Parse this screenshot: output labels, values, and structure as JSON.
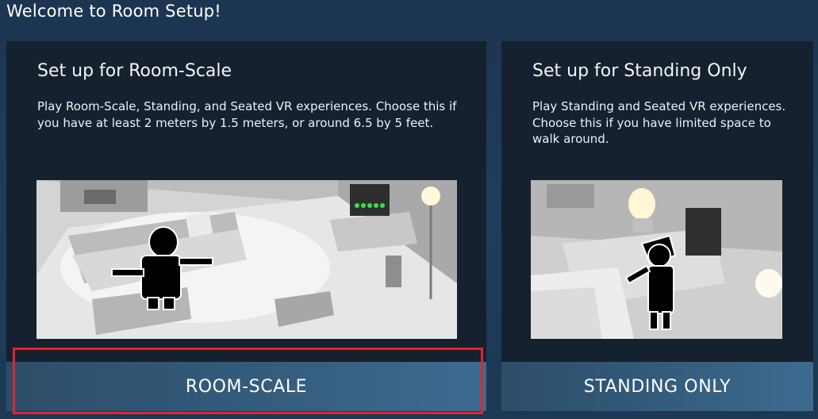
{
  "window": {
    "title": "Welcome to Room Setup!"
  },
  "panels": {
    "room_scale": {
      "heading": "Set up for Room-Scale",
      "description": "Play Room-Scale, Standing, and Seated VR experiences. Choose this if you have at least 2 meters by 1.5 meters, or around 6.5 by 5 feet.",
      "button_label": "ROOM-SCALE",
      "selected": true
    },
    "standing_only": {
      "heading": "Set up for Standing Only",
      "description": "Play Standing and Seated VR experiences. Choose this if you have limited space to walk around.",
      "button_label": "STANDING ONLY",
      "selected": false
    }
  },
  "colors": {
    "background": "#1f3d5a",
    "panel": "#15212e",
    "button": "#335b7b",
    "highlight": "#e02530"
  }
}
